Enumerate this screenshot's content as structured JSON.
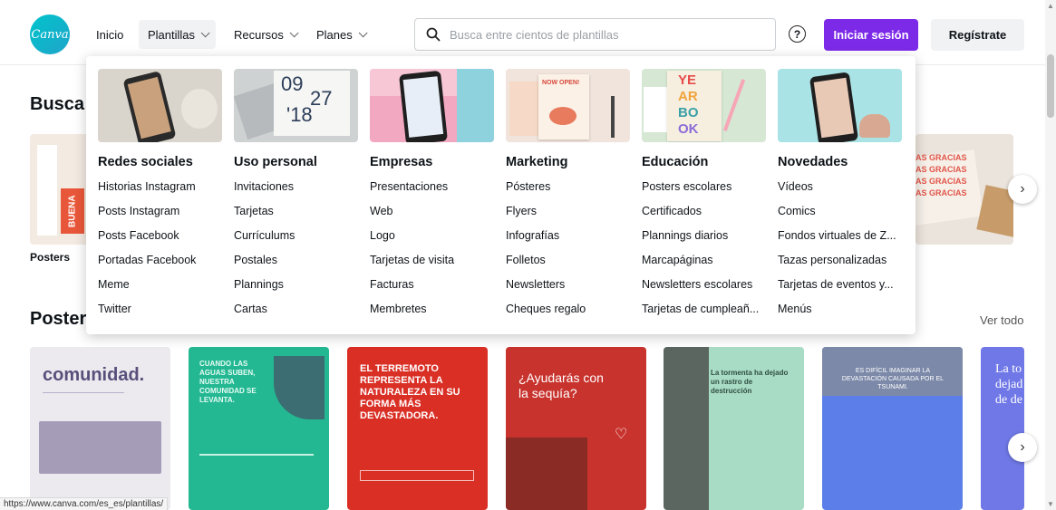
{
  "header": {
    "logo_text": "Canva",
    "nav": [
      {
        "label": "Inicio",
        "has_chevron": false
      },
      {
        "label": "Plantillas",
        "has_chevron": true
      },
      {
        "label": "Recursos",
        "has_chevron": true
      },
      {
        "label": "Planes",
        "has_chevron": true
      }
    ],
    "search_placeholder": "Busca entre cientos de plantillas",
    "help_icon": "question-circle-icon",
    "login_label": "Iniciar sesión",
    "register_label": "Regístrate",
    "accent_color": "#7d2ae8"
  },
  "page": {
    "section1_title": "Busca",
    "section1_caption": "Posters",
    "section2_title": "Poster",
    "view_all": "Ver todo",
    "next_arrow": "›",
    "status_url": "https://www.canva.com/es_es/plantillas/"
  },
  "poster_cards": [
    {
      "headline": "comunidad.",
      "color": "#ece9ef"
    },
    {
      "headline": "CUANDO LAS AGUAS SUBEN, NUESTRA COMUNIDAD SE LEVANTA.",
      "color": "#24b892"
    },
    {
      "headline": "EL TERREMOTO REPRESENTA LA NATURALEZA EN SU FORMA MÁS DEVASTADORA.",
      "color": "#d92f25"
    },
    {
      "headline": "¿Ayudarás con la sequía?",
      "color": "#c8332d"
    },
    {
      "headline": "La tormenta ha dejado un rastro de destrucción",
      "color": "#a9dcc4"
    },
    {
      "headline": "ES DIFÍCIL IMAGINAR LA DEVASTACIÓN CAUSADA POR EL TSUNAMI.",
      "color": "#5b7ee8"
    },
    {
      "headline": "La to dejad de de",
      "color": "#6f78e6"
    }
  ],
  "dropdown": {
    "columns": [
      {
        "title": "Redes sociales",
        "links": [
          "Historias Instagram",
          "Posts Instagram",
          "Posts Facebook",
          "Portadas Facebook",
          "Meme",
          "Twitter"
        ]
      },
      {
        "title": "Uso personal",
        "links": [
          "Invitaciones",
          "Tarjetas",
          "Currículums",
          "Postales",
          "Plannings",
          "Cartas"
        ]
      },
      {
        "title": "Empresas",
        "links": [
          "Presentaciones",
          "Web",
          "Logo",
          "Tarjetas de visita",
          "Facturas",
          "Membretes"
        ]
      },
      {
        "title": "Marketing",
        "links": [
          "Pósteres",
          "Flyers",
          "Infografías",
          "Folletos",
          "Newsletters",
          "Cheques regalo"
        ]
      },
      {
        "title": "Educación",
        "links": [
          "Posters escolares",
          "Certificados",
          "Plannings diarios",
          "Marcapáginas",
          "Newsletters escolares",
          "Tarjetas de cumpleañ..."
        ]
      },
      {
        "title": "Novedades",
        "links": [
          "Vídeos",
          "Comics",
          "Fondos virtuales de Z...",
          "Tazas personalizadas",
          "Tarjetas de eventos y...",
          "Menús"
        ]
      }
    ],
    "thumb_texts": {
      "uso_personal": [
        "09",
        "27",
        "'18"
      ],
      "marketing": "NOW OPEN!",
      "educacion": [
        "YE",
        "AR",
        "BO",
        "OK"
      ]
    }
  },
  "side_banner_text": "AS GRACIAS"
}
